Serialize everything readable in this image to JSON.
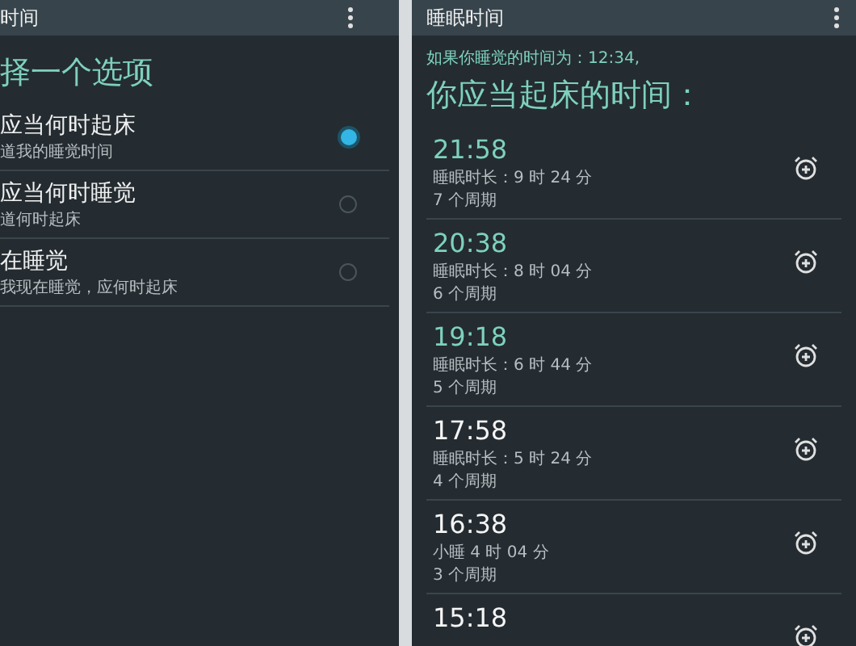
{
  "left_screen": {
    "title": "时间",
    "heading": "择一个选项",
    "options": [
      {
        "title": "应当何时起床",
        "subtitle": "道我的睡觉时间",
        "selected": true
      },
      {
        "title": "应当何时睡觉",
        "subtitle": "道何时起床",
        "selected": false
      },
      {
        "title": "在睡觉",
        "subtitle": "我现在睡觉，应何时起床",
        "selected": false
      }
    ]
  },
  "right_screen": {
    "title": "睡眠时间",
    "intro": "如果你睡觉的时间为：12:34,",
    "heading": "你应当起床的时间：",
    "times": [
      {
        "time": "21:58",
        "duration": "睡眠时长：9 时 24 分",
        "cycles": "7 个周期",
        "highlighted": true
      },
      {
        "time": "20:38",
        "duration": "睡眠时长：8 时 04 分",
        "cycles": "6 个周期",
        "highlighted": true
      },
      {
        "time": "19:18",
        "duration": "睡眠时长：6 时 44 分",
        "cycles": "5 个周期",
        "highlighted": true
      },
      {
        "time": "17:58",
        "duration": "睡眠时长：5 时 24 分",
        "cycles": "4 个周期",
        "highlighted": false
      },
      {
        "time": "16:38",
        "duration": "小睡 4 时 04 分",
        "cycles": "3 个周期",
        "highlighted": false
      },
      {
        "time": "15:18",
        "highlighted": false
      }
    ]
  }
}
